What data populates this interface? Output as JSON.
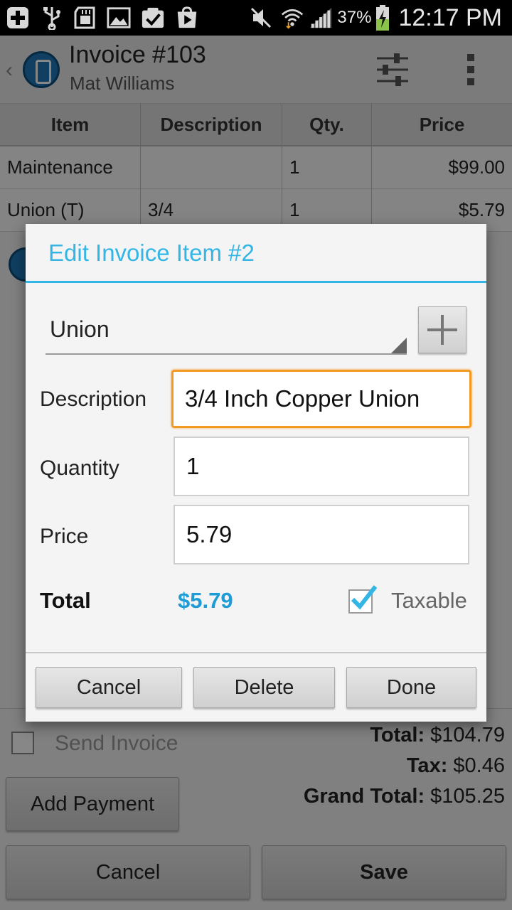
{
  "status_bar": {
    "battery": "37%",
    "time": "12:17 PM",
    "icons": [
      "add-icon",
      "usb-icon",
      "sd-card-icon",
      "gallery-icon",
      "task-check-icon",
      "play-store-icon",
      "mute-icon",
      "wifi-icon",
      "signal-icon",
      "battery-charging-icon"
    ]
  },
  "action_bar": {
    "title": "Invoice #103",
    "subtitle": "Mat Williams",
    "back_glyph": "‹",
    "icons": [
      "app-logo-icon",
      "filter-sliders-icon",
      "overflow-menu-icon"
    ]
  },
  "table": {
    "headers": [
      "Item",
      "Description",
      "Qty.",
      "Price"
    ],
    "rows": [
      [
        "Maintenance",
        "",
        "1",
        "$99.00"
      ],
      [
        "Union (T)",
        "3/4",
        "1",
        "$5.79"
      ]
    ]
  },
  "summary": {
    "send_invoice_label": "Send Invoice",
    "send_invoice_checked": false,
    "total_label": "Total:",
    "total_value": "$104.79",
    "tax_label": "Tax:",
    "tax_value": "$0.46",
    "grand_total_label": "Grand Total:",
    "grand_total_value": "$105.25",
    "add_payment_label": "Add Payment",
    "cancel_label": "Cancel",
    "save_label": "Save"
  },
  "dialog": {
    "title": "Edit Invoice Item #2",
    "item_selected": "Union",
    "description_label": "Description",
    "description_value": "3/4 Inch Copper Union",
    "quantity_label": "Quantity",
    "quantity_value": "1",
    "price_label": "Price",
    "price_value": "5.79",
    "total_label": "Total",
    "total_value": "$5.79",
    "taxable_label": "Taxable",
    "taxable_checked": true,
    "cancel_label": "Cancel",
    "delete_label": "Delete",
    "done_label": "Done"
  },
  "colors": {
    "accent": "#33b5e5",
    "total_value": "#1f9bd6",
    "focus_border": "#f39a24",
    "app_logo": "#1f78b8"
  }
}
